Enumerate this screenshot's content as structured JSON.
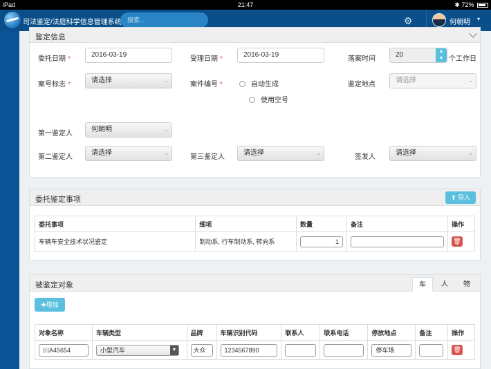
{
  "status_bar": {
    "device": "iPad",
    "time": "21:47",
    "battery": "72%"
  },
  "header": {
    "app_title": "司法鉴定/法庭科学信息管理系统",
    "search_placeholder": "搜索...",
    "user_name": "何朝明"
  },
  "appraisal_info": {
    "title": "鉴定信息",
    "entrust_date_label": "委托日期",
    "entrust_date_value": "2016-03-19",
    "accept_date_label": "受理日期",
    "accept_date_value": "2016-03-19",
    "close_time_label": "落案时间",
    "close_time_value": "20",
    "close_time_unit": "个工作日",
    "case_mark_label": "案号标志",
    "case_mark_value": "请选择",
    "case_number_label": "案件编号",
    "radio_auto": "自动生成",
    "radio_empty": "使用空号",
    "location_label": "鉴定地点",
    "location_value": "请选择",
    "appraiser1_label": "第一鉴定人",
    "appraiser1_value": "何朝明",
    "appraiser2_label": "第二鉴定人",
    "appraiser2_value": "请选择",
    "appraiser3_label": "第三鉴定人",
    "appraiser3_value": "请选择",
    "issuer_label": "签发人",
    "issuer_value": "请选择"
  },
  "entrusted_items": {
    "title": "委托鉴定事项",
    "import_label": "导入",
    "columns": [
      "委托事项",
      "细项",
      "数量",
      "备注",
      "操作"
    ],
    "rows": [
      {
        "item": "车辆车安全技术状况鉴定",
        "details": "制动系, 行车制动系, 转向系",
        "quantity": "1",
        "note": ""
      }
    ]
  },
  "objects": {
    "title": "被鉴定对象",
    "tabs": [
      "车",
      "人",
      "物"
    ],
    "active_tab": "车",
    "add_label": "增加",
    "columns": [
      "对象名称",
      "车辆类型",
      "品牌",
      "车辆识别代码",
      "联系人",
      "联系电话",
      "停放地点",
      "备注",
      "操作"
    ],
    "rows": [
      {
        "name": "川A45654",
        "vehicle_type": "小型汽车",
        "brand": "大众",
        "vin": "1234567890",
        "contact": "",
        "phone": "",
        "parking": "停车场",
        "note": ""
      }
    ]
  },
  "colors": {
    "topbar": "#0a4f8a",
    "sidebar": "#0b5394",
    "accent": "#5bc0de",
    "danger": "#d9534f"
  }
}
